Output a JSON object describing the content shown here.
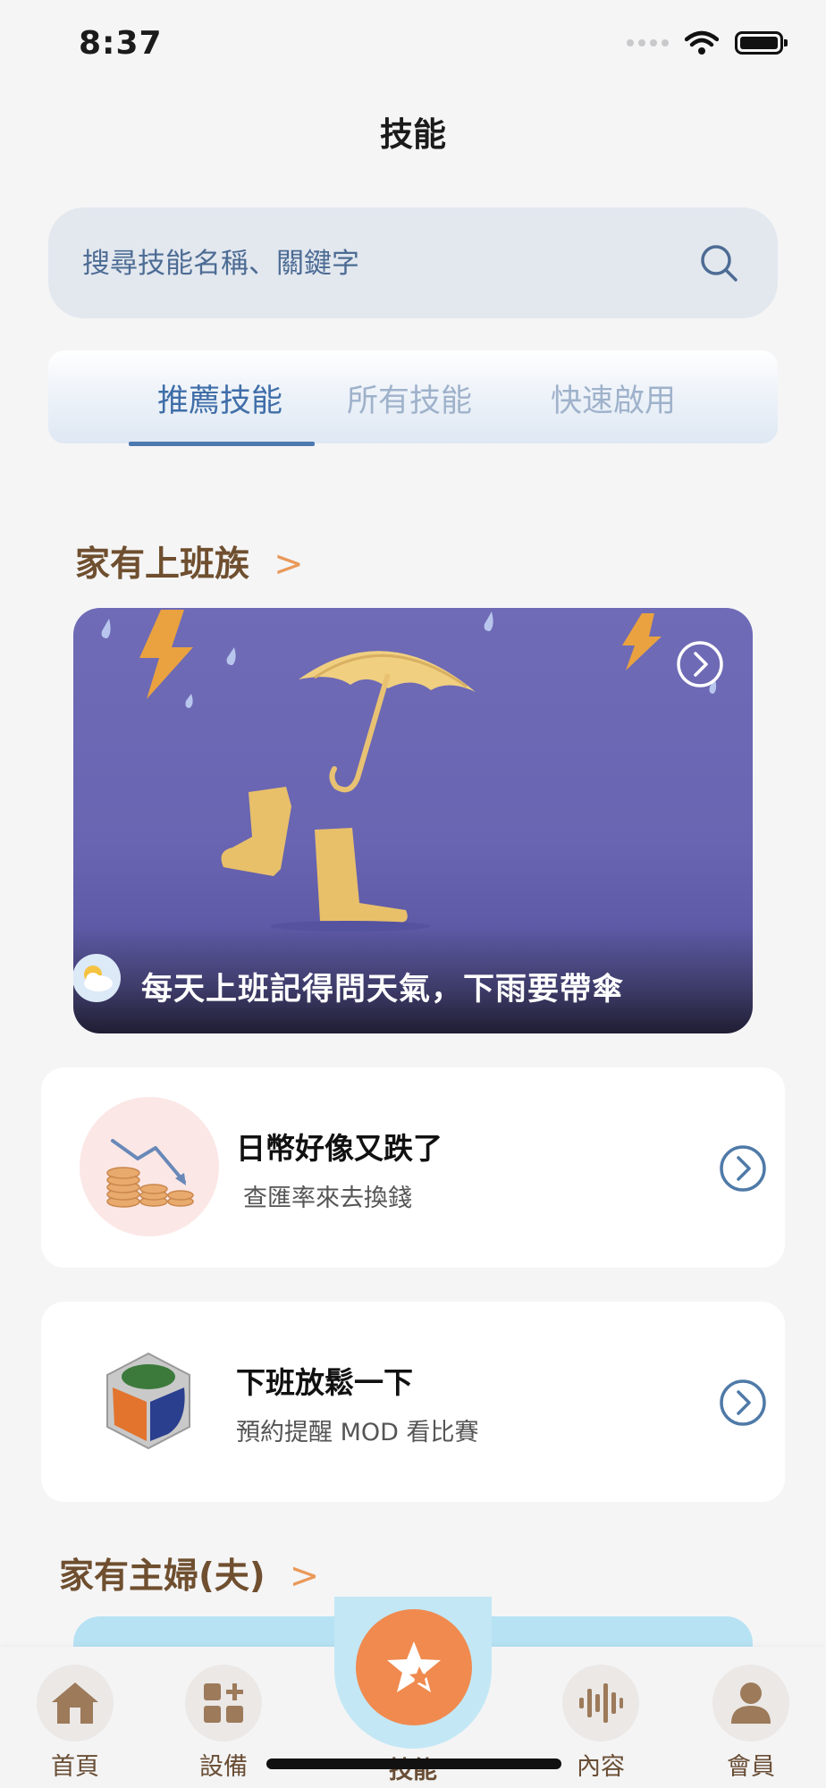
{
  "status_bar": {
    "time": "8:37"
  },
  "header": {
    "title": "技能"
  },
  "search": {
    "placeholder": "搜尋技能名稱、關鍵字"
  },
  "tabs": [
    {
      "label": "推薦技能",
      "active": true
    },
    {
      "label": "所有技能",
      "active": false
    },
    {
      "label": "快速啟用",
      "active": false
    }
  ],
  "sections": [
    {
      "title": "家有上班族",
      "hero": {
        "caption": "每天上班記得問天氣，下雨要帶傘",
        "icon": "weather-icon"
      },
      "items": [
        {
          "title": "日幣好像又跌了",
          "subtitle": "查匯率來去換錢",
          "icon": "exchange-rate-icon"
        },
        {
          "title": "下班放鬆一下",
          "subtitle": "預約提醒 MOD 看比賽",
          "icon": "mod-cube-icon"
        }
      ]
    },
    {
      "title": "家有主婦(夫)"
    }
  ],
  "bottom_nav": [
    {
      "label": "首頁",
      "icon": "home-icon"
    },
    {
      "label": "設備",
      "icon": "devices-icon"
    },
    {
      "label": "技能",
      "icon": "star-icon",
      "active": true
    },
    {
      "label": "內容",
      "icon": "audio-wave-icon"
    },
    {
      "label": "會員",
      "icon": "user-icon"
    }
  ],
  "colors": {
    "accent": "#4c78b0",
    "section_title": "#6f4f2f",
    "fab": "#f08a4f"
  }
}
